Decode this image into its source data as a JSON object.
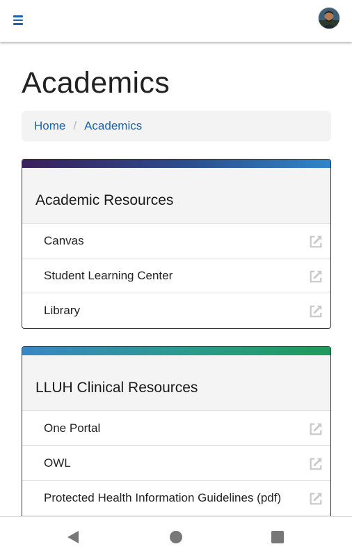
{
  "header": {
    "menu_icon": "hamburger-menu-icon",
    "avatar": "user-avatar"
  },
  "page": {
    "title": "Academics"
  },
  "breadcrumb": {
    "items": [
      "Home",
      "Academics"
    ],
    "separator": "/"
  },
  "cards": [
    {
      "title": "Academic Resources",
      "bar_colors": [
        "#3a1f5c",
        "#2c4f8e",
        "#2f86c8"
      ],
      "items": [
        {
          "label": "Canvas",
          "icon": "external-link-icon"
        },
        {
          "label": "Student Learning Center",
          "icon": "external-link-icon"
        },
        {
          "label": "Library",
          "icon": "external-link-icon"
        }
      ]
    },
    {
      "title": "LLUH Clinical Resources",
      "bar_colors": [
        "#3a86c4",
        "#2a9a8a",
        "#1f9a5a"
      ],
      "items": [
        {
          "label": "One Portal",
          "icon": "external-link-icon"
        },
        {
          "label": "OWL",
          "icon": "external-link-icon"
        },
        {
          "label": "Protected Health Information Guidelines (pdf)",
          "icon": "external-link-icon"
        }
      ]
    }
  ],
  "system_nav": {
    "buttons": [
      "back-icon",
      "home-icon",
      "recents-icon"
    ]
  },
  "colors": {
    "link": "#1a64b3",
    "icon_grey": "#c8c8c8"
  }
}
